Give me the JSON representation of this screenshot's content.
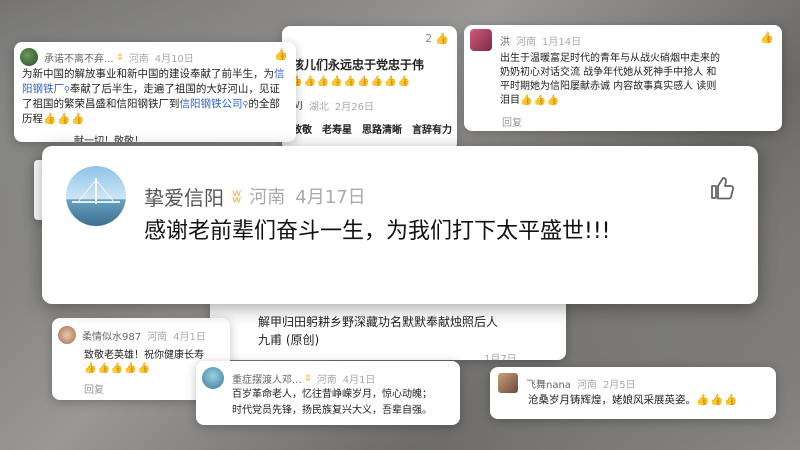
{
  "c1": {
    "name": "承诺不离不弃...",
    "region": "河南",
    "date": "4月10日",
    "text_a": "为新中国的解放事业和新中国的建设奉献了前半生，为",
    "link1": "信阳钢铁厂",
    "text_b": "奉献了后半生，走遍了祖国的大好河山，见证了祖国的繁荣昌盛和信阳钢铁厂到",
    "link2": "信阳钢铁公司",
    "text_c": "的全部历程",
    "emoji": "👍👍👍",
    "peek": "献一切！敬敬！"
  },
  "c2": {
    "text": "孩儿们永远忠于党忠于伟",
    "likes": "2",
    "emoji": "👍👍👍👍👍👍👍👍👍",
    "name": "WJ",
    "region": "湖北",
    "date": "2月26日",
    "peek": "致敬　老寿星　思路清晰　言辞有力　一脉旺"
  },
  "c3": {
    "name": "洪",
    "region": "河南",
    "date": "1月14日",
    "text": "出生于温暖富足时代的青年与从战火硝烟中走来的奶奶初心对话交流 战争年代她从死神手中抢人 和平时期她为信阳屡献赤诚 内容故事真实感人 读则泪目",
    "emoji": "👍👍👍",
    "reply": "回复"
  },
  "main": {
    "name": "挚爱信阳",
    "region": "河南",
    "date": "4月17日",
    "text": "感谢老前辈们奋斗一生，为我们打下太平盛世!!!"
  },
  "c5": {
    "line1": "解甲归田躬耕乡野深藏功名默默奉献烛照后人",
    "line2": "九甫 (原创)",
    "date": "1月7日"
  },
  "c6": {
    "name": "柔情似水987",
    "region": "河南",
    "date": "4月1日",
    "text": "致敬老英雄！祝你健康长寿",
    "emoji": "👍👍👍👍👍",
    "reply": "回复"
  },
  "c7": {
    "name": "重症摆渡人邓...",
    "region": "河南",
    "date": "4月1日",
    "line1": "百岁革命老人，忆往昔峥嵘岁月，惊心动魄；",
    "line2": "时代党员先锋，扬民族复兴大义，吾辈自强。"
  },
  "c8": {
    "name": "飞舞nana",
    "region": "河南",
    "date": "2月5日",
    "text": "沧桑岁月铸辉煌，姥娘风采展英姿。",
    "emoji": "👍👍👍"
  },
  "colors": {
    "link": "#2d63c8",
    "vip": "#f2b233"
  }
}
